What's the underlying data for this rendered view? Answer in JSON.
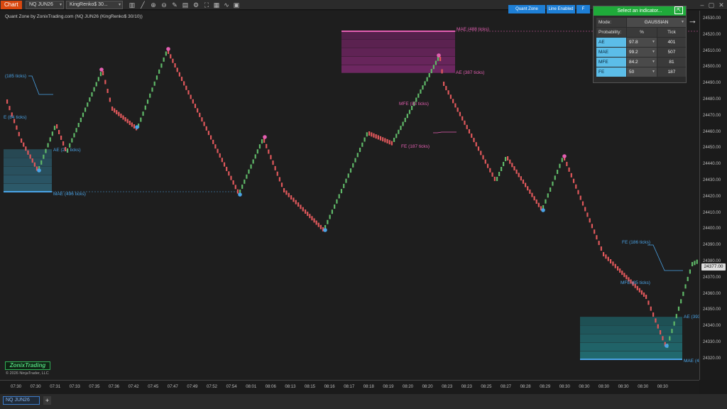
{
  "toolbar": {
    "chart_label": "Chart",
    "instrument": "NQ JUN26",
    "bar_type": "KingRenko$ 30..."
  },
  "chart": {
    "caption": "Quant Zone by ZonixTrading.com (NQ JUN26 (KingRenko$ 30/10))",
    "current_price": "24377.00",
    "y_ticks": [
      "24530.00",
      "24520.00",
      "24510.00",
      "24500.00",
      "24490.00",
      "24480.00",
      "24470.00",
      "24460.00",
      "24450.00",
      "24440.00",
      "24430.00",
      "24420.00",
      "24410.00",
      "24400.00",
      "24390.00",
      "24380.00",
      "24370.00",
      "24360.00",
      "24350.00",
      "24340.00",
      "24330.00",
      "24320.00"
    ],
    "x_ticks": [
      "07:30",
      "07:30",
      "07:31",
      "07:33",
      "07:35",
      "07:36",
      "07:42",
      "07:45",
      "07:47",
      "07:49",
      "07:52",
      "07:54",
      "08:01",
      "08:06",
      "08:13",
      "08:15",
      "08:16",
      "08:17",
      "08:18",
      "08:19",
      "08:20",
      "08:20",
      "08:23",
      "08:23",
      "08:25",
      "08:27",
      "08:28",
      "08:29",
      "08:30",
      "08:30",
      "08:30",
      "08:30",
      "08:30",
      "08:30"
    ]
  },
  "buttons": {
    "quant_zone": "Quant Zone",
    "line_enabled": "Line Enabled",
    "f": "F"
  },
  "indicator_panel": {
    "header": "Select an indicator...",
    "mode_label": "Mode:",
    "mode_value": "GAUSSIAN",
    "prob_label": "Probability:",
    "col_pct": "%",
    "col_tick": "Tick",
    "rows": [
      {
        "name": "AE",
        "pct": "97.8",
        "tick": "401"
      },
      {
        "name": "MAE",
        "pct": "99.2",
        "tick": "507"
      },
      {
        "name": "MFE",
        "pct": "84.2",
        "tick": "81"
      },
      {
        "name": "FE",
        "pct": "50",
        "tick": "187"
      }
    ]
  },
  "annotations": {
    "mae_top": "MAE (488 ticks)",
    "ae_top": "AE (387 ticks)",
    "mfe_top": "MFE (83 ticks)",
    "fe_top": "FE (187 ticks)",
    "ticks_left": "(185 ticks)",
    "fe_left": "E (84 ticks)",
    "ae_left": "AE (2... ticks)",
    "mae_left": "MAE (496 ticks)",
    "fe_right": "FE (186 ticks)",
    "mfe_right": "MFE (85 ticks)",
    "ae_right": "AE (393",
    "mae_right": "MAE (4..."
  },
  "footer": {
    "logo": "ZonixTrading",
    "copyright": "© 2026 NinjaTrader, LLC",
    "tab": "NQ JUN26",
    "add_tab": "+"
  },
  "colors": {
    "up": "#5fb868",
    "down": "#e0585b",
    "pink": "#e35fb1",
    "blue": "#4aa3e6",
    "panel_green": "#1faa3a"
  }
}
